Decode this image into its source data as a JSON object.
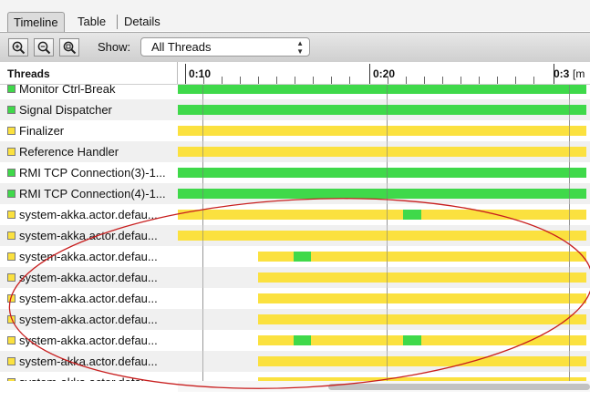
{
  "tabs": [
    {
      "label": "Timeline",
      "active": true
    },
    {
      "label": "Table",
      "active": false
    },
    {
      "label": "Details",
      "active": false
    }
  ],
  "toolbar": {
    "zoom_in_icon": "zoom-in-icon",
    "zoom_out_icon": "zoom-out-icon",
    "zoom_fit_icon": "zoom-fit-icon",
    "show_label": "Show:",
    "show_value": "All Threads"
  },
  "timeline": {
    "column_header": "Threads",
    "ticks": [
      "0:10",
      "0:20",
      "0:3"
    ],
    "unit_fragment": "[m",
    "colors": {
      "running": "#3fd94a",
      "waiting": "#fbe13f"
    }
  },
  "threads": [
    {
      "name": "Monitor Ctrl-Break",
      "color": "green",
      "segments": [
        [
          0,
          1,
          "green"
        ]
      ]
    },
    {
      "name": "Signal Dispatcher",
      "color": "green",
      "segments": [
        [
          0,
          1,
          "green"
        ]
      ]
    },
    {
      "name": "Finalizer",
      "color": "yellow",
      "segments": [
        [
          0,
          1,
          "yellow"
        ]
      ]
    },
    {
      "name": "Reference Handler",
      "color": "yellow",
      "segments": [
        [
          0,
          1,
          "yellow"
        ]
      ]
    },
    {
      "name": "RMI TCP Connection(3)-1...",
      "color": "green",
      "segments": [
        [
          0,
          1,
          "green"
        ]
      ]
    },
    {
      "name": "RMI TCP Connection(4)-1...",
      "color": "green",
      "segments": [
        [
          0,
          1,
          "green"
        ]
      ]
    },
    {
      "name": "system-akka.actor.defau...",
      "color": "yellow",
      "segments": [
        [
          0,
          1,
          "yellow"
        ],
        [
          0.552,
          0.596,
          "green"
        ]
      ]
    },
    {
      "name": "system-akka.actor.defau...",
      "color": "yellow",
      "segments": [
        [
          0,
          1,
          "yellow"
        ]
      ]
    },
    {
      "name": "system-akka.actor.defau...",
      "color": "yellow",
      "segments": [
        [
          0.196,
          1,
          "yellow"
        ],
        [
          0.283,
          0.327,
          "green"
        ]
      ]
    },
    {
      "name": "system-akka.actor.defau...",
      "color": "yellow",
      "segments": [
        [
          0.196,
          1,
          "yellow"
        ]
      ]
    },
    {
      "name": "system-akka.actor.defau...",
      "color": "yellow",
      "segments": [
        [
          0.196,
          1,
          "yellow"
        ]
      ]
    },
    {
      "name": "system-akka.actor.defau...",
      "color": "yellow",
      "segments": [
        [
          0.196,
          1,
          "yellow"
        ]
      ]
    },
    {
      "name": "system-akka.actor.defau...",
      "color": "yellow",
      "segments": [
        [
          0.196,
          1,
          "yellow"
        ],
        [
          0.283,
          0.327,
          "green"
        ],
        [
          0.552,
          0.596,
          "green"
        ]
      ]
    },
    {
      "name": "system-akka.actor.defau...",
      "color": "yellow",
      "segments": [
        [
          0.196,
          1,
          "yellow"
        ]
      ]
    },
    {
      "name": "system-akka.actor.defau...",
      "color": "yellow",
      "segments": [
        [
          0.196,
          1,
          "yellow"
        ]
      ]
    }
  ]
}
